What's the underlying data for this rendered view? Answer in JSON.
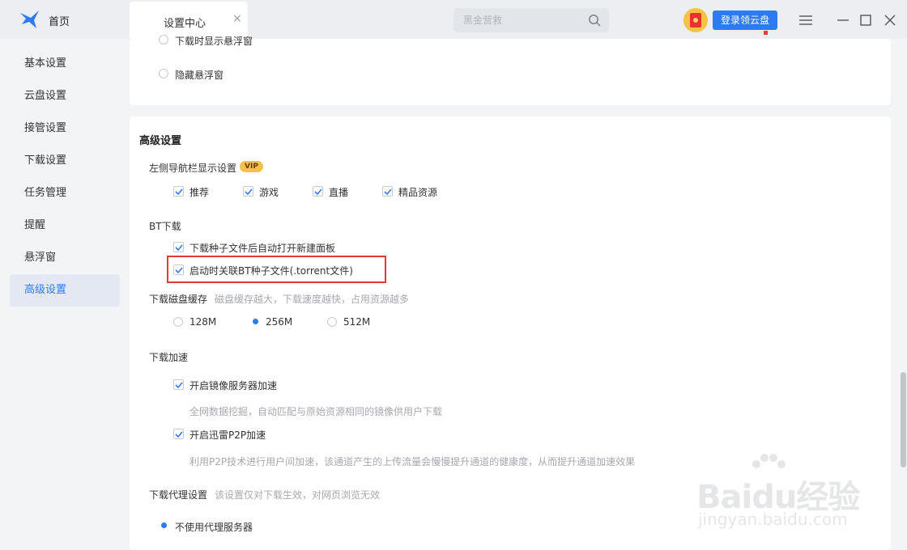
{
  "topbar": {
    "home_label": "首页",
    "tab_label": "设置中心",
    "tab_close": "×",
    "search_placeholder": "黑金营救",
    "login_button": "登录领云盘"
  },
  "sidebar": {
    "items": [
      {
        "label": "基本设置",
        "active": false
      },
      {
        "label": "云盘设置",
        "active": false
      },
      {
        "label": "接管设置",
        "active": false
      },
      {
        "label": "下载设置",
        "active": false
      },
      {
        "label": "任务管理",
        "active": false
      },
      {
        "label": "提醒",
        "active": false
      },
      {
        "label": "悬浮窗",
        "active": false
      },
      {
        "label": "高级设置",
        "active": true
      }
    ]
  },
  "floating_window": {
    "options": [
      {
        "label": "下载时显示悬浮窗",
        "checked": false
      },
      {
        "label": "隐藏悬浮窗",
        "checked": false
      }
    ]
  },
  "advanced": {
    "title": "高级设置",
    "nav_display": {
      "label": "左侧导航栏显示设置",
      "badge": "VIP",
      "options": [
        {
          "label": "推荐",
          "checked": true
        },
        {
          "label": "游戏",
          "checked": true
        },
        {
          "label": "直播",
          "checked": true
        },
        {
          "label": "精品资源",
          "checked": true
        }
      ]
    },
    "bt": {
      "label": "BT下载",
      "options": [
        {
          "label": "下载种子文件后自动打开新建面板",
          "checked": true
        },
        {
          "label": "启动时关联BT种子文件(.torrent文件)",
          "checked": true
        }
      ]
    },
    "disk_cache": {
      "label": "下载磁盘缓存",
      "hint": "磁盘缓存越大，下载速度越快，占用资源越多",
      "options": [
        {
          "label": "128M",
          "checked": false
        },
        {
          "label": "256M",
          "checked": true
        },
        {
          "label": "512M",
          "checked": false
        }
      ]
    },
    "acceleration": {
      "label": "下载加速",
      "mirror": {
        "label": "开启镜像服务器加速",
        "checked": true,
        "desc": "全网数据挖掘，自动匹配与原始资源相同的镜像供用户下载"
      },
      "p2p": {
        "label": "开启迅雷P2P加速",
        "checked": true,
        "desc": "利用P2P技术进行用户间加速，该通道产生的上传流量会慢慢提升通道的健康度，从而提升通道加速效果"
      }
    },
    "proxy": {
      "label": "下载代理设置",
      "hint": "该设置仅对下载生效，对网页浏览无效",
      "option": {
        "label": "不使用代理服务器",
        "checked": true
      }
    }
  },
  "watermark": {
    "brand": "Baidu经验",
    "url": "jingyan.baidu.com"
  },
  "colors": {
    "accent": "#2d7bf2",
    "highlight": "#e53935",
    "vip": "#f2c14e"
  }
}
